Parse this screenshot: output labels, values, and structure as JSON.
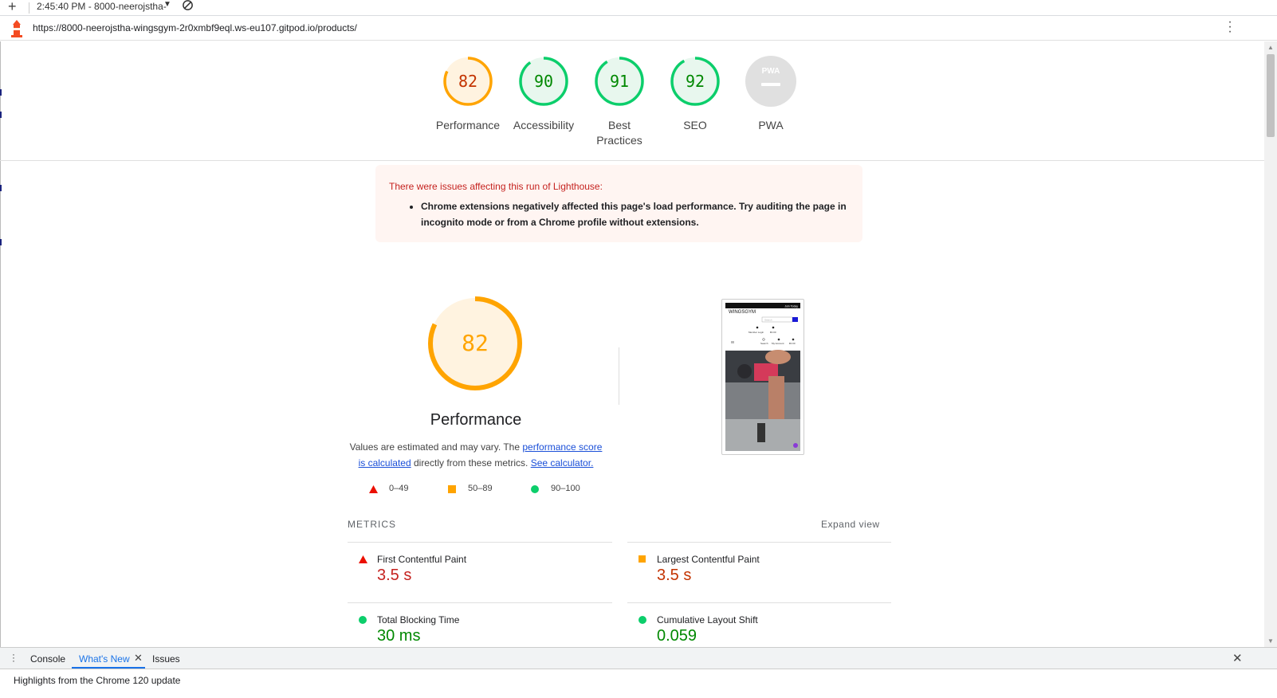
{
  "topbar": {
    "session_label": "2:45:40 PM - 8000-neerojstha-",
    "plus_icon": "plus-icon",
    "block_icon": "block-icon"
  },
  "urlbar": {
    "url": "https://8000-neerojstha-wingsgym-2r0xmbf9eql.ws-eu107.gitpod.io/products/",
    "icon": "lighthouse-icon"
  },
  "gauges": [
    {
      "label": "Performance",
      "value": "82",
      "score": 0.82,
      "status": "average"
    },
    {
      "label": "Accessibility",
      "value": "90",
      "score": 0.9,
      "status": "pass"
    },
    {
      "label": "Best Practices",
      "value": "91",
      "score": 0.91,
      "status": "pass"
    },
    {
      "label": "SEO",
      "value": "92",
      "score": 0.92,
      "status": "pass"
    },
    {
      "label": "PWA",
      "value": "",
      "status": "na"
    }
  ],
  "warning": {
    "title": "There were issues affecting this run of Lighthouse:",
    "items": [
      "Chrome extensions negatively affected this page's load performance. Try auditing the page in incognito mode or from a Chrome profile without extensions."
    ]
  },
  "performance": {
    "score": "82",
    "score_fraction": 0.82,
    "title": "Performance",
    "desc_before": "Values are estimated and may vary. The ",
    "link1": "performance score is calculated",
    "desc_middle": " directly from these metrics. ",
    "link2": "See calculator."
  },
  "legend": {
    "fail": "0–49",
    "average": "50–89",
    "pass": "90–100"
  },
  "metrics": {
    "heading": "METRICS",
    "expand": "Expand view",
    "items": [
      {
        "name": "First Contentful Paint",
        "value": "3.5 s",
        "status": "fail"
      },
      {
        "name": "Largest Contentful Paint",
        "value": "3.5 s",
        "status": "average"
      },
      {
        "name": "Total Blocking Time",
        "value": "30 ms",
        "status": "pass"
      },
      {
        "name": "Cumulative Layout Shift",
        "value": "0.059",
        "status": "pass"
      }
    ]
  },
  "screenshot": {
    "brand": "WINGSGYM",
    "banner": "Join Today",
    "search_placeholder": "Search",
    "links": [
      "Member Login",
      "€0.00",
      "Search",
      "My Account",
      "€0.00"
    ]
  },
  "drawer": {
    "tabs": [
      "Console",
      "What's New",
      "Issues"
    ],
    "active_tab": "What's New",
    "highlights": "Highlights from the Chrome 120 update"
  },
  "colors": {
    "fail": "#eb0f00",
    "average": "#ffa400",
    "pass": "#0cce6b",
    "average_text": "#c33300",
    "pass_text": "#008800",
    "fail_text": "#c5221f"
  }
}
